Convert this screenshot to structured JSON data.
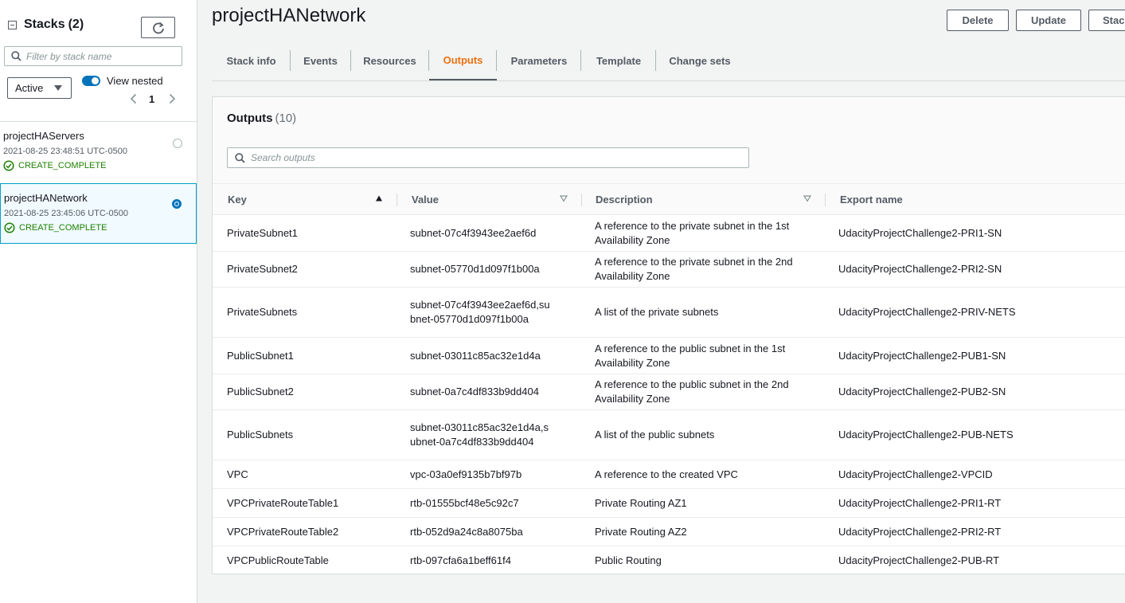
{
  "sidebar": {
    "title": "Stacks",
    "count": "(2)",
    "filter_placeholder": "Filter by stack name",
    "status_filter": "Active",
    "view_nested_label": "View nested",
    "page": "1",
    "stacks": [
      {
        "name": "projectHAServers",
        "time": "2021-08-25 23:48:51 UTC-0500",
        "status": "CREATE_COMPLETE",
        "selected": false
      },
      {
        "name": "projectHANetwork",
        "time": "2021-08-25 23:45:06 UTC-0500",
        "status": "CREATE_COMPLETE",
        "selected": true
      }
    ]
  },
  "header": {
    "title": "projectHANetwork",
    "actions": {
      "delete": "Delete",
      "update": "Update",
      "stack_actions": "Stac"
    }
  },
  "tabs": [
    "Stack info",
    "Events",
    "Resources",
    "Outputs",
    "Parameters",
    "Template",
    "Change sets"
  ],
  "active_tab": "Outputs",
  "outputs": {
    "title": "Outputs",
    "count": "(10)",
    "search_placeholder": "Search outputs",
    "columns": {
      "key": "Key",
      "value": "Value",
      "description": "Description",
      "export": "Export name"
    },
    "rows": [
      {
        "key": "PrivateSubnet1",
        "value": "subnet-07c4f3943ee2aef6d",
        "description": "A reference to the private subnet in the 1st Availability Zone",
        "export": "UdacityProjectChallenge2-PRI1-SN"
      },
      {
        "key": "PrivateSubnet2",
        "value": "subnet-05770d1d097f1b00a",
        "description": "A reference to the private subnet in the 2nd Availability Zone",
        "export": "UdacityProjectChallenge2-PRI2-SN"
      },
      {
        "key": "PrivateSubnets",
        "value": "subnet-07c4f3943ee2aef6d,subnet-05770d1d097f1b00a",
        "description": "A list of the private subnets",
        "export": "UdacityProjectChallenge2-PRIV-NETS"
      },
      {
        "key": "PublicSubnet1",
        "value": "subnet-03011c85ac32e1d4a",
        "description": "A reference to the public subnet in the 1st Availability Zone",
        "export": "UdacityProjectChallenge2-PUB1-SN"
      },
      {
        "key": "PublicSubnet2",
        "value": "subnet-0a7c4df833b9dd404",
        "description": "A reference to the public subnet in the 2nd Availability Zone",
        "export": "UdacityProjectChallenge2-PUB2-SN"
      },
      {
        "key": "PublicSubnets",
        "value": "subnet-03011c85ac32e1d4a,subnet-0a7c4df833b9dd404",
        "description": "A list of the public subnets",
        "export": "UdacityProjectChallenge2-PUB-NETS"
      },
      {
        "key": "VPC",
        "value": "vpc-03a0ef9135b7bf97b",
        "description": "A reference to the created VPC",
        "export": "UdacityProjectChallenge2-VPCID"
      },
      {
        "key": "VPCPrivateRouteTable1",
        "value": "rtb-01555bcf48e5c92c7",
        "description": "Private Routing AZ1",
        "export": "UdacityProjectChallenge2-PRI1-RT"
      },
      {
        "key": "VPCPrivateRouteTable2",
        "value": "rtb-052d9a24c8a8075ba",
        "description": "Private Routing AZ2",
        "export": "UdacityProjectChallenge2-PRI2-RT"
      },
      {
        "key": "VPCPublicRouteTable",
        "value": "rtb-097cfa6a1beff61f4",
        "description": "Public Routing",
        "export": "UdacityProjectChallenge2-PUB-RT"
      }
    ]
  },
  "colors": {
    "accent": "#ec7211",
    "link": "#0073bb",
    "success": "#1d8102",
    "text": "#16191f",
    "muted": "#545b64"
  }
}
